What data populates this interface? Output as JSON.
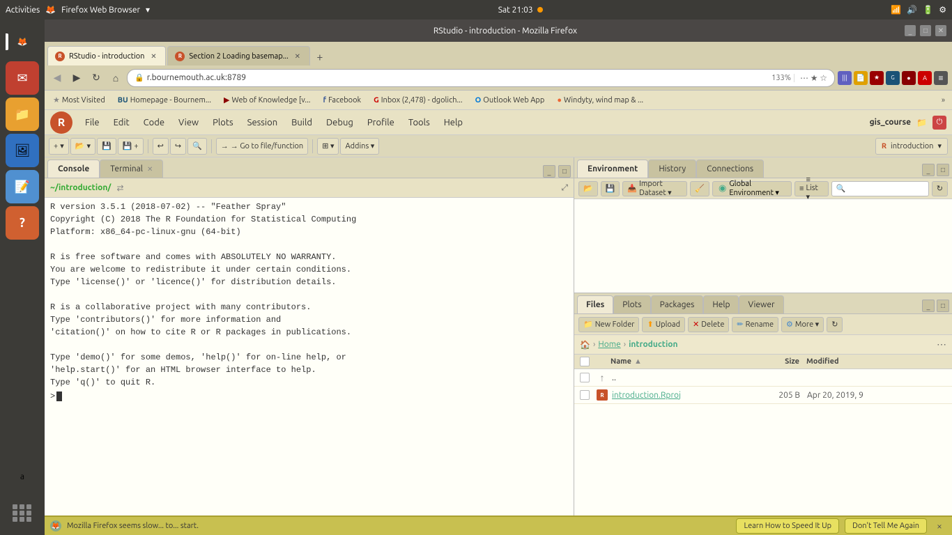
{
  "system_bar": {
    "activities": "Activities",
    "browser_name": "Firefox Web Browser",
    "time": "Sat 21:03",
    "dot": true
  },
  "browser": {
    "title": "RStudio - introduction - Mozilla Firefox",
    "tabs": [
      {
        "id": "tab1",
        "title": "RStudio - introduction",
        "active": true,
        "favicon": "R"
      },
      {
        "id": "tab2",
        "title": "Section 2 Loading basemap...",
        "active": false,
        "favicon": "R"
      }
    ],
    "new_tab_label": "+",
    "url": "r.bournemouth.ac.uk:8789",
    "zoom": "133%",
    "bookmarks": [
      {
        "label": "Most Visited",
        "star": true
      },
      {
        "label": "BU Homepage - Bournem..."
      },
      {
        "label": "Web of Knowledge [v..."
      },
      {
        "label": "Facebook"
      },
      {
        "label": "Inbox (2,478) - dgolich..."
      },
      {
        "label": "Outlook Web App"
      },
      {
        "label": "Windyty, wind map & ..."
      }
    ],
    "bookmarks_more": "»"
  },
  "rstudio": {
    "menu_items": [
      "File",
      "Edit",
      "Code",
      "View",
      "Plots",
      "Session",
      "Build",
      "Debug",
      "Profile",
      "Tools",
      "Help"
    ],
    "project_name": "gis_course",
    "toolbar": {
      "new_file": "+",
      "open": "📂",
      "save": "💾",
      "go_to_file": "→ Go to file/function",
      "addins": "Addins ▾"
    },
    "project_indicator": "introduction",
    "console_panel": {
      "tabs": [
        "Console",
        "Terminal ×"
      ],
      "active_tab": "Console",
      "path": "~/introduction/",
      "content": "R version 3.5.1 (2018-07-02) -- \"Feather Spray\"\nCopyright (C) 2018 The R Foundation for Statistical Computing\nPlatform: x86_64-pc-linux-gnu (64-bit)\n\nR is free software and comes with ABSOLUTELY NO WARRANTY.\nYou are welcome to redistribute it under certain conditions.\nType 'license()' or 'licence()' for distribution details.\n\nR is a collaborative project with many contributors.\nType 'contributors()' for more information and\n'citation()' on how to cite R or R packages in publications.\n\nType 'demo()' for some demos, 'help()' for on-line help, or\n'help.start()' for an HTML browser interface to help.\nType 'q()' to quit R.",
      "prompt": "> "
    },
    "env_panel": {
      "tabs": [
        "Environment",
        "History",
        "Connections"
      ],
      "active_tab": "Environment",
      "scope": "Global Environment ▾",
      "import_dataset": "Import Dataset ▾",
      "view_mode": "≡ List ▾"
    },
    "files_panel": {
      "tabs": [
        "Files",
        "Plots",
        "Packages",
        "Help",
        "Viewer"
      ],
      "active_tab": "Files",
      "toolbar_buttons": [
        "New Folder",
        "Upload",
        "Delete",
        "Rename",
        "More ▾",
        "↻"
      ],
      "breadcrumb": {
        "home": "🏠",
        "path": [
          "Home",
          "introduction"
        ]
      },
      "columns": {
        "name": "Name",
        "sort_arrow": "▲",
        "size": "Size",
        "modified": "Modified"
      },
      "files": [
        {
          "type": "up",
          "name": "..",
          "size": "",
          "modified": ""
        },
        {
          "type": "rproj",
          "name": "introduction.Rproj",
          "size": "205 B",
          "modified": "Apr 20, 2019, 9"
        }
      ]
    }
  },
  "status_bar": {
    "icon": "🦊",
    "message": "Mozilla Firefox seems slow... to... start.",
    "speed_up_btn": "Learn How to Speed It Up",
    "dismiss_btn": "Don't Tell Me Again",
    "close_btn": "×"
  },
  "dock": {
    "items": [
      {
        "id": "firefox",
        "icon": "🦊",
        "active": true
      },
      {
        "id": "mail",
        "icon": "✉",
        "active": false
      },
      {
        "id": "files",
        "icon": "📁",
        "active": false
      },
      {
        "id": "photos",
        "icon": "🖼",
        "active": false
      },
      {
        "id": "text",
        "icon": "📝",
        "active": false
      },
      {
        "id": "help",
        "icon": "?",
        "active": false
      },
      {
        "id": "amazon",
        "icon": "a",
        "active": false
      },
      {
        "id": "apps",
        "icon": "⋯",
        "active": false,
        "bottom": true
      }
    ]
  }
}
